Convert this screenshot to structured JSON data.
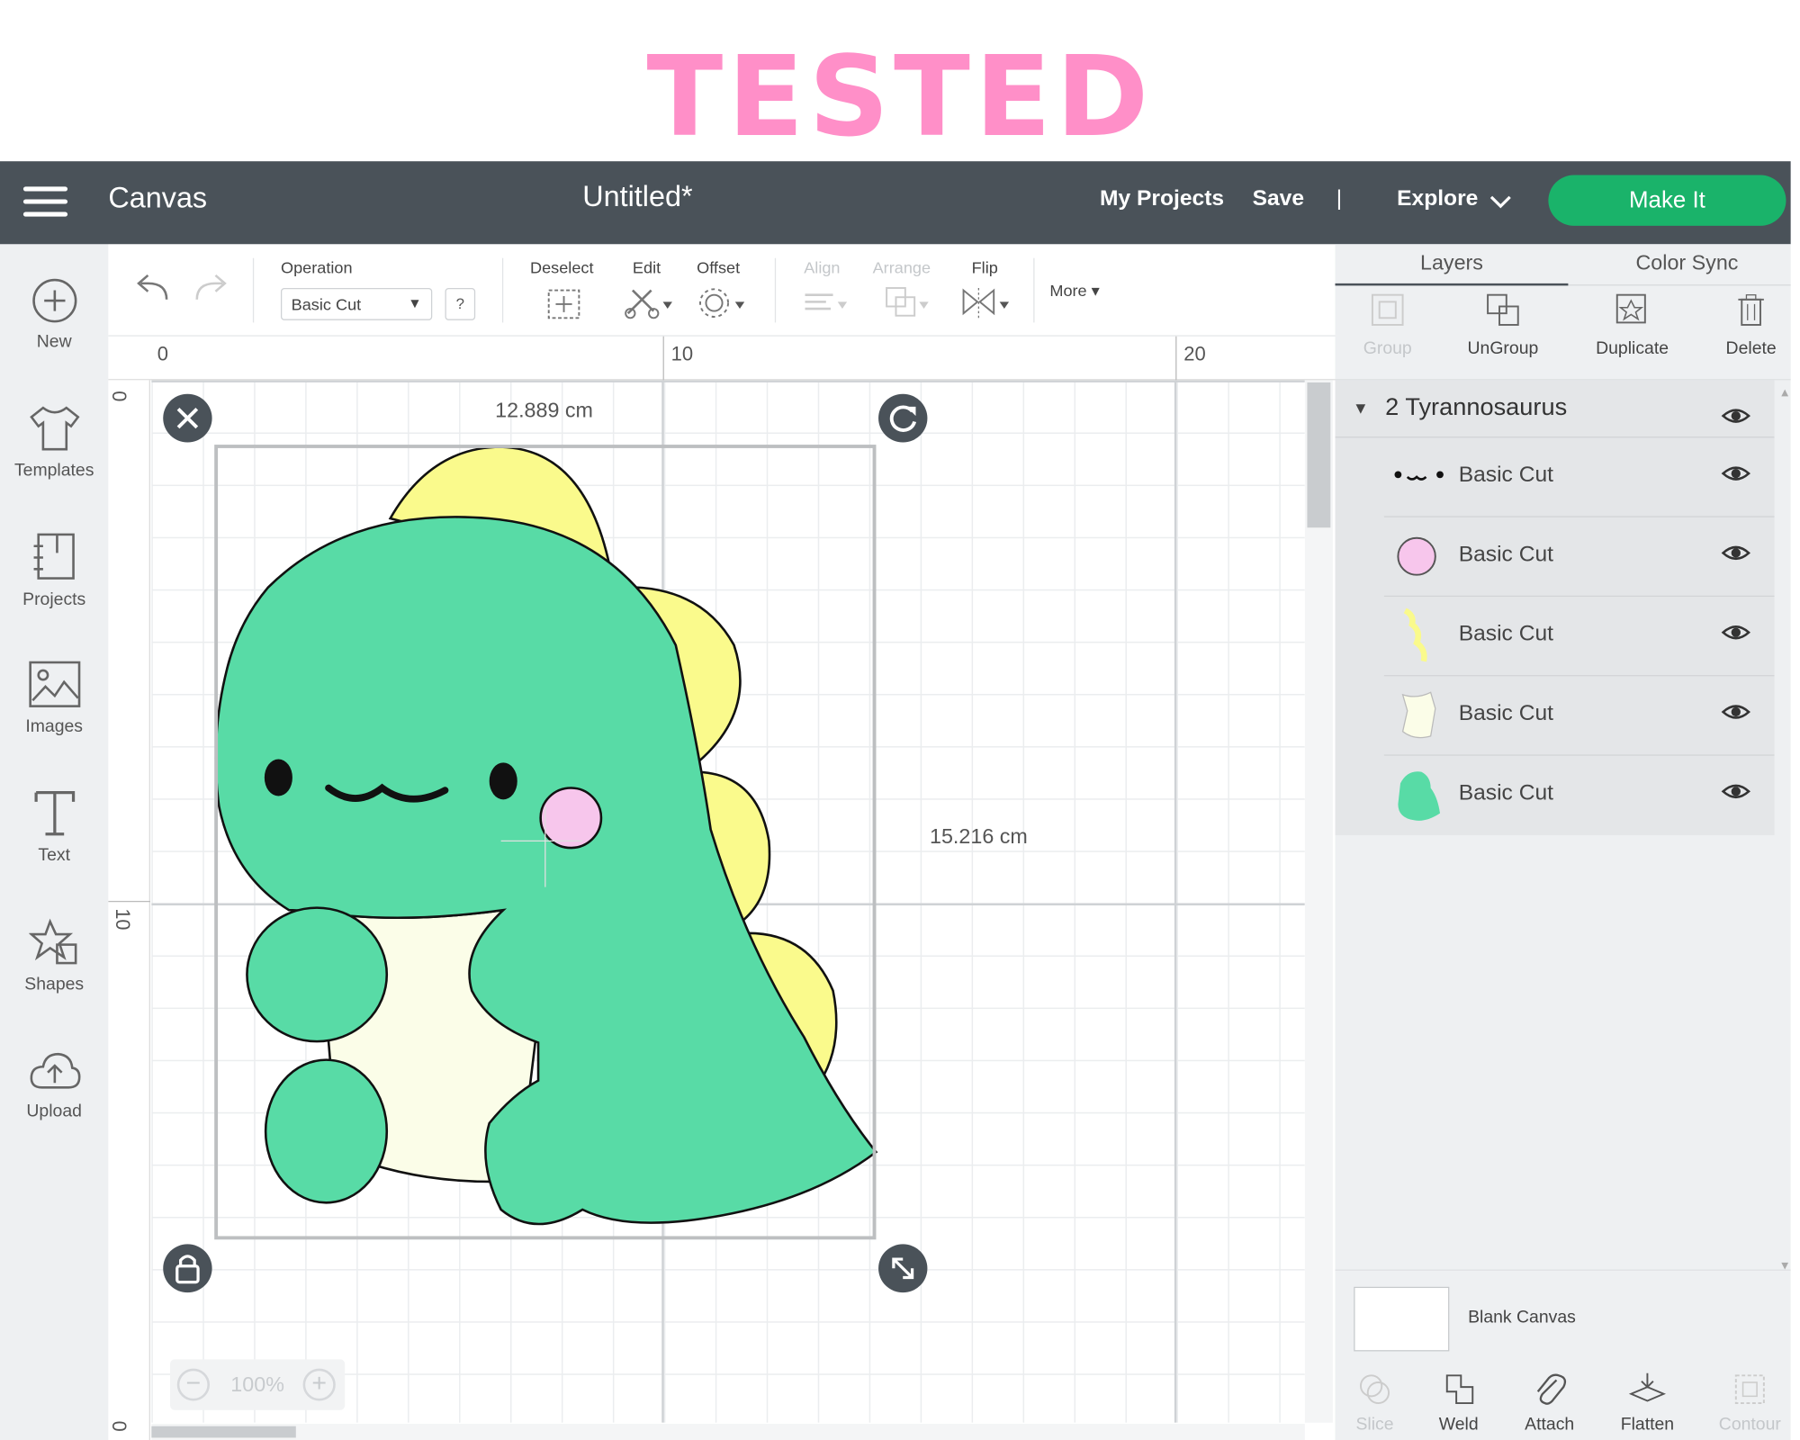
{
  "banner": {
    "text": "TESTED"
  },
  "topbar": {
    "app_title": "Canvas",
    "doc_title": "Untitled*",
    "my_projects": "My Projects",
    "save": "Save",
    "separator": "|",
    "explore": "Explore",
    "make_it": "Make It"
  },
  "sidebar": {
    "items": [
      {
        "label": "New",
        "icon": "plus-circle-icon"
      },
      {
        "label": "Templates",
        "icon": "tshirt-icon"
      },
      {
        "label": "Projects",
        "icon": "projects-icon"
      },
      {
        "label": "Images",
        "icon": "image-icon"
      },
      {
        "label": "Text",
        "icon": "text-icon"
      },
      {
        "label": "Shapes",
        "icon": "shapes-icon"
      },
      {
        "label": "Upload",
        "icon": "upload-cloud-icon"
      }
    ]
  },
  "toolbar": {
    "operation_label": "Operation",
    "operation_value": "Basic Cut",
    "help": "?",
    "deselect": "Deselect",
    "edit": "Edit",
    "offset": "Offset",
    "align": "Align",
    "arrange": "Arrange",
    "flip": "Flip",
    "more": "More"
  },
  "rulers": {
    "top": [
      "0",
      "10",
      "20"
    ],
    "left": [
      "0",
      "10",
      "0"
    ]
  },
  "canvas": {
    "width_label": "12.889 cm",
    "height_label": "15.216 cm",
    "zoom": "100%"
  },
  "layers_panel": {
    "tabs": [
      "Layers",
      "Color Sync"
    ],
    "tools": [
      {
        "label": "Group",
        "enabled": false
      },
      {
        "label": "UnGroup",
        "enabled": true
      },
      {
        "label": "Duplicate",
        "enabled": true
      },
      {
        "label": "Delete",
        "enabled": true
      }
    ],
    "group_title": "2 Tyrannosaurus",
    "layers": [
      {
        "name": "Basic Cut",
        "thumb": "face-features",
        "color": "#111111"
      },
      {
        "name": "Basic Cut",
        "thumb": "cheek",
        "color": "#f7c6ec"
      },
      {
        "name": "Basic Cut",
        "thumb": "spikes",
        "color": "#fafa8c"
      },
      {
        "name": "Basic Cut",
        "thumb": "belly",
        "color": "#fbfde8"
      },
      {
        "name": "Basic Cut",
        "thumb": "body",
        "color": "#58dba6"
      }
    ],
    "blank_canvas": "Blank Canvas",
    "bottom_tools": [
      {
        "label": "Slice",
        "enabled": false
      },
      {
        "label": "Weld",
        "enabled": true
      },
      {
        "label": "Attach",
        "enabled": true
      },
      {
        "label": "Flatten",
        "enabled": true
      },
      {
        "label": "Contour",
        "enabled": false
      }
    ]
  },
  "colors": {
    "brand_green": "#1ab36a",
    "topbar": "#4a5259",
    "banner_pink": "#ff8fc8",
    "dino_green": "#58dba6",
    "dino_yellow": "#fafa8c",
    "dino_belly": "#fbfde8",
    "dino_cheek": "#f7c6ec"
  }
}
